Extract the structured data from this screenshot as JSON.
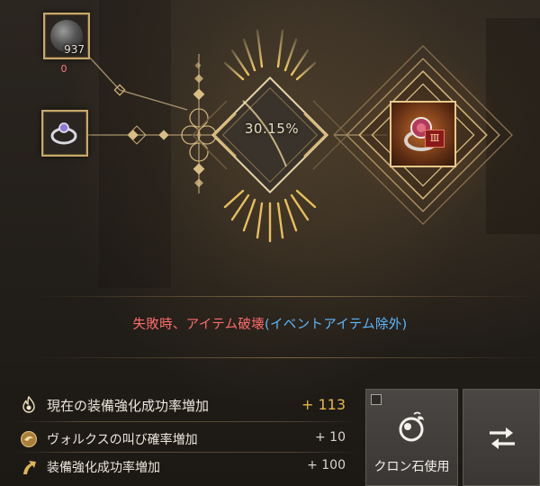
{
  "enhance": {
    "success_rate": "30.15%",
    "failure_warning": "失敗時、アイテム破壊",
    "failure_note": "(イベントアイテム除外)"
  },
  "materials": {
    "stone_count": "937",
    "stone_required": "0"
  },
  "bonuses": [
    {
      "label": "現在の装備強化成功率増加",
      "value": "+ 113",
      "icon": "flame-icon"
    },
    {
      "label": "ヴォルクスの叫び確率増加",
      "value": "+ 10",
      "icon": "volks-cry-icon"
    },
    {
      "label": "装備強化成功率増加",
      "value": "+ 100",
      "icon": "upgrade-arrow-icon"
    }
  ],
  "buttons": {
    "cron_label": "クロン石使用",
    "swap": "swap-arrows-icon"
  },
  "colors": {
    "gold": "#c8a96a",
    "warning_red": "#ff6b6b",
    "note_blue": "#5fb8ff",
    "bonus_highlight": "#e6b64a"
  }
}
